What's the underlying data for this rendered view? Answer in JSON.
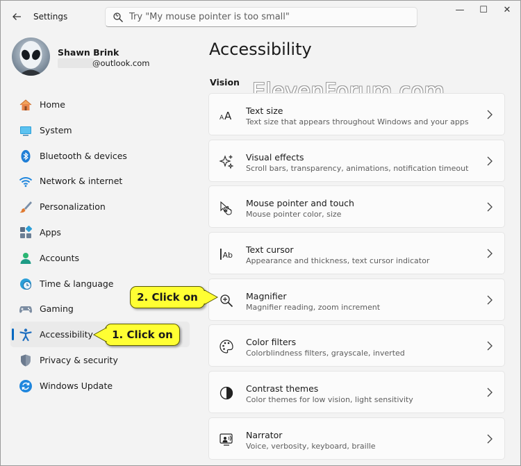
{
  "window": {
    "app_title": "Settings",
    "controls": {
      "minimize": "—",
      "maximize": "☐",
      "close": "✕"
    }
  },
  "search": {
    "placeholder": "Try \"My mouse pointer is too small\""
  },
  "profile": {
    "name": "Shawn Brink",
    "email_suffix": "@outlook.com"
  },
  "sidebar": {
    "items": [
      {
        "label": "Home",
        "icon": "home-icon",
        "selected": false
      },
      {
        "label": "System",
        "icon": "system-icon",
        "selected": false
      },
      {
        "label": "Bluetooth & devices",
        "icon": "bluetooth-icon",
        "selected": false
      },
      {
        "label": "Network & internet",
        "icon": "wifi-icon",
        "selected": false
      },
      {
        "label": "Personalization",
        "icon": "brush-icon",
        "selected": false
      },
      {
        "label": "Apps",
        "icon": "apps-icon",
        "selected": false
      },
      {
        "label": "Accounts",
        "icon": "person-icon",
        "selected": false
      },
      {
        "label": "Time & language",
        "icon": "clock-globe-icon",
        "selected": false
      },
      {
        "label": "Gaming",
        "icon": "gamepad-icon",
        "selected": false
      },
      {
        "label": "Accessibility",
        "icon": "accessibility-icon",
        "selected": true
      },
      {
        "label": "Privacy & security",
        "icon": "shield-icon",
        "selected": false
      },
      {
        "label": "Windows Update",
        "icon": "update-icon",
        "selected": false
      }
    ]
  },
  "main": {
    "title": "Accessibility",
    "section": "Vision",
    "watermark": "ElevenForum.com",
    "cards": [
      {
        "title": "Text size",
        "subtitle": "Text size that appears throughout Windows and your apps",
        "icon": "text-size-icon"
      },
      {
        "title": "Visual effects",
        "subtitle": "Scroll bars, transparency, animations, notification timeout",
        "icon": "sparkle-icon"
      },
      {
        "title": "Mouse pointer and touch",
        "subtitle": "Mouse pointer color, size",
        "icon": "pointer-icon"
      },
      {
        "title": "Text cursor",
        "subtitle": "Appearance and thickness, text cursor indicator",
        "icon": "text-cursor-icon"
      },
      {
        "title": "Magnifier",
        "subtitle": "Magnifier reading, zoom increment",
        "icon": "magnifier-icon"
      },
      {
        "title": "Color filters",
        "subtitle": "Colorblindness filters, grayscale, inverted",
        "icon": "palette-icon"
      },
      {
        "title": "Contrast themes",
        "subtitle": "Color themes for low vision, light sensitivity",
        "icon": "contrast-icon"
      },
      {
        "title": "Narrator",
        "subtitle": "Voice, verbosity, keyboard, braille",
        "icon": "narrator-icon"
      }
    ]
  },
  "annotations": {
    "step1": "1. Click on",
    "step2": "2. Click on"
  },
  "colors": {
    "accent": "#0067c0",
    "callout": "#ffff33"
  }
}
